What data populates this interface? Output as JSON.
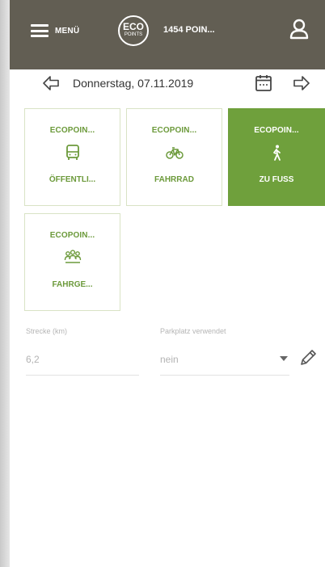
{
  "header": {
    "menu_label": "MENÜ",
    "logo_line1": "ECO",
    "logo_line2": "POINTS",
    "points_label": "1454 POIN..."
  },
  "datebar": {
    "date": "Donnerstag, 07.11.2019"
  },
  "tiles": [
    {
      "title": "ECOPOIN...",
      "label": "ÖFFENTLI...",
      "icon": "bus-icon",
      "selected": false
    },
    {
      "title": "ECOPOIN...",
      "label": "FAHRRAD",
      "icon": "bicycle-icon",
      "selected": false
    },
    {
      "title": "ECOPOIN...",
      "label": "ZU FUSS",
      "icon": "walking-icon",
      "selected": true
    },
    {
      "title": "ECOPOIN...",
      "label": "FAHRGE...",
      "icon": "carpool-icon",
      "selected": false
    }
  ],
  "form": {
    "distance_label": "Strecke (km)",
    "distance_value": "6,2",
    "parking_label": "Parkplatz verwendet",
    "parking_value": "nein"
  },
  "colors": {
    "topbar": "#625e53",
    "accent": "#6fa03c",
    "tile_text": "#6c9a3b"
  }
}
